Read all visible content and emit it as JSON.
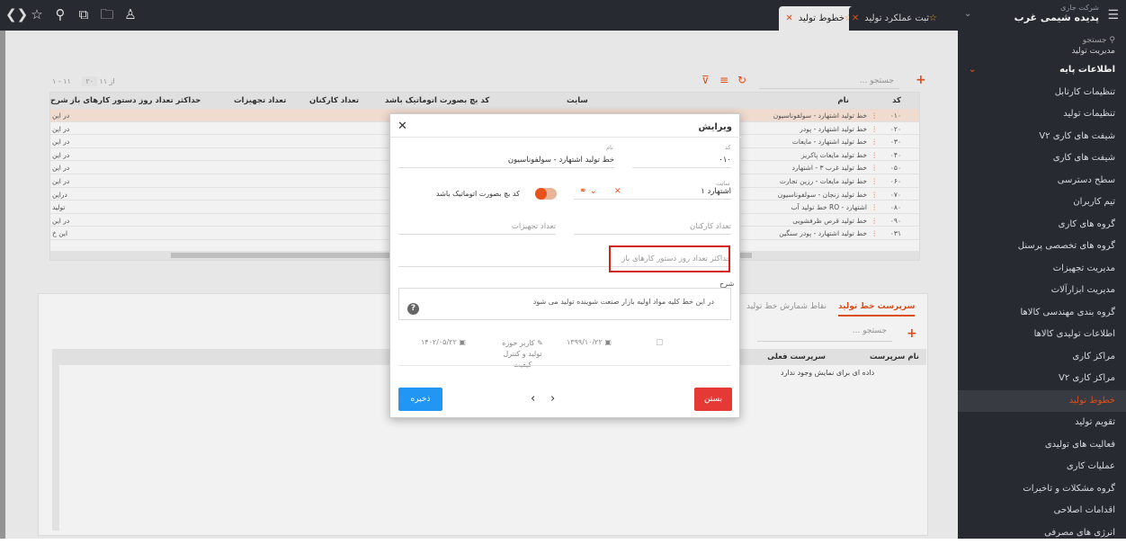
{
  "topbar": {
    "icons": [
      "logo-icon",
      "star-icon",
      "filter-icon",
      "share-icon",
      "folder-icon",
      "user-icon"
    ],
    "tabs": [
      {
        "label": "خطوط تولید",
        "active": true
      },
      {
        "label": "ثبت عملکرد تولید",
        "active": false
      }
    ],
    "company_sub": "شرکت جاری",
    "company": "پدیده شیمی غرب"
  },
  "sidebar": {
    "search": "جستجو",
    "module": "مدیریت تولید",
    "group": "اطلاعات پایه",
    "items": [
      "تنظیمات کارتابل",
      "تنظیمات تولید",
      "شیفت های کاری V۲",
      "شیفت های کاری",
      "سطح دسترسی",
      "تیم کاربران",
      "گروه های کاری",
      "گروه های تخصصی پرسنل",
      "مدیریت تجهیزات",
      "مدیریت ابزارآلات",
      "گروه بندی مهندسی کالاها",
      "اطلاعات تولیدی کالاها",
      "مراکز کاری",
      "مراکز کاری V۲",
      "خطوط تولید",
      "تقویم تولید",
      "فعالیت های تولیدی",
      "عملیات کاری",
      "گروه مشکلات و تاخیرات",
      "اقدامات اصلاحی",
      "انرژی های مصرفی"
    ],
    "active_index": 14
  },
  "grid": {
    "search_placeholder": "جستجو ...",
    "pager": "۱ - ۱۱ از ۱۱",
    "page_size": "۲۰",
    "columns": [
      "کد",
      "نام",
      "سایت",
      "کد بچ بصورت اتوماتیک باشد",
      "تعداد کارکنان",
      "تعداد تجهیزات",
      "حداکثر تعداد روز دستور کارهای باز",
      "شرح"
    ],
    "rows": [
      {
        "code": "۰۱۰",
        "name": "خط تولید اشتهارد - سولفوناسیون",
        "desc": "در این"
      },
      {
        "code": "۰۲۰",
        "name": "خط تولید اشتهارد - پودر",
        "desc": "در این"
      },
      {
        "code": "۰۳۰",
        "name": "خط تولید اشتهارد - مایعات",
        "desc": "در این"
      },
      {
        "code": "۰۴۰",
        "name": "خط تولید مایعات پاکریز",
        "desc": "در این"
      },
      {
        "code": "۰۵۰",
        "name": "خط تولید غرب ۳ - اشتهارد",
        "desc": "در این"
      },
      {
        "code": "۰۶۰",
        "name": "خط تولید مایعات - رزین تجارت",
        "desc": "در این"
      },
      {
        "code": "۰۷۰",
        "name": "خط تولید زنجان - سولفوناسیون",
        "desc": "دراین"
      },
      {
        "code": "۰۸۰",
        "name": "خط تولید آب RO - اشتهارد",
        "desc": "تولید"
      },
      {
        "code": "۰۹۰",
        "name": "خط تولید قرص ظرفشویی",
        "desc": "در این"
      },
      {
        "code": "۰۳۱",
        "name": "خط تولید اشتهارد - پودر سنگین",
        "desc": "این خ"
      }
    ]
  },
  "lower": {
    "tabs": [
      "سرپرست خط تولید",
      "نقاط شمارش خط تولید"
    ],
    "search_placeholder": "جستجو ...",
    "columns": [
      "نام سرپرست",
      "سرپرست فعلی"
    ],
    "empty": "داده ای برای نمایش وجود ندارد"
  },
  "modal": {
    "title": "ویرایش",
    "code_label": "کد",
    "code_value": "۰۱۰",
    "name_label": "نام",
    "name_value": "خط تولید اشتهارد - سولفوناسیون",
    "site_label": "سایت",
    "site_value": "اشتهارد ۱",
    "batch_label": "کد بچ بصورت اتوماتیک باشد",
    "staff_placeholder": "تعداد کارکنان",
    "equipment_placeholder": "تعداد تجهیزات",
    "max_days_placeholder": "حداکثر تعداد روز دستور کارهای باز",
    "desc_label": "شرح",
    "desc_value": "در این خط کلیه مواد اولیه بازار صنعت شوینده تولید می شود",
    "created_date": "۱۳۹۹/۱۰/۲۲",
    "user": "کاربر حوزه تولید و کنترل کیفیت",
    "modified_date": "۱۴۰۲/۰۵/۲۲",
    "close_label": "بستن",
    "save_label": "ذخیره"
  }
}
